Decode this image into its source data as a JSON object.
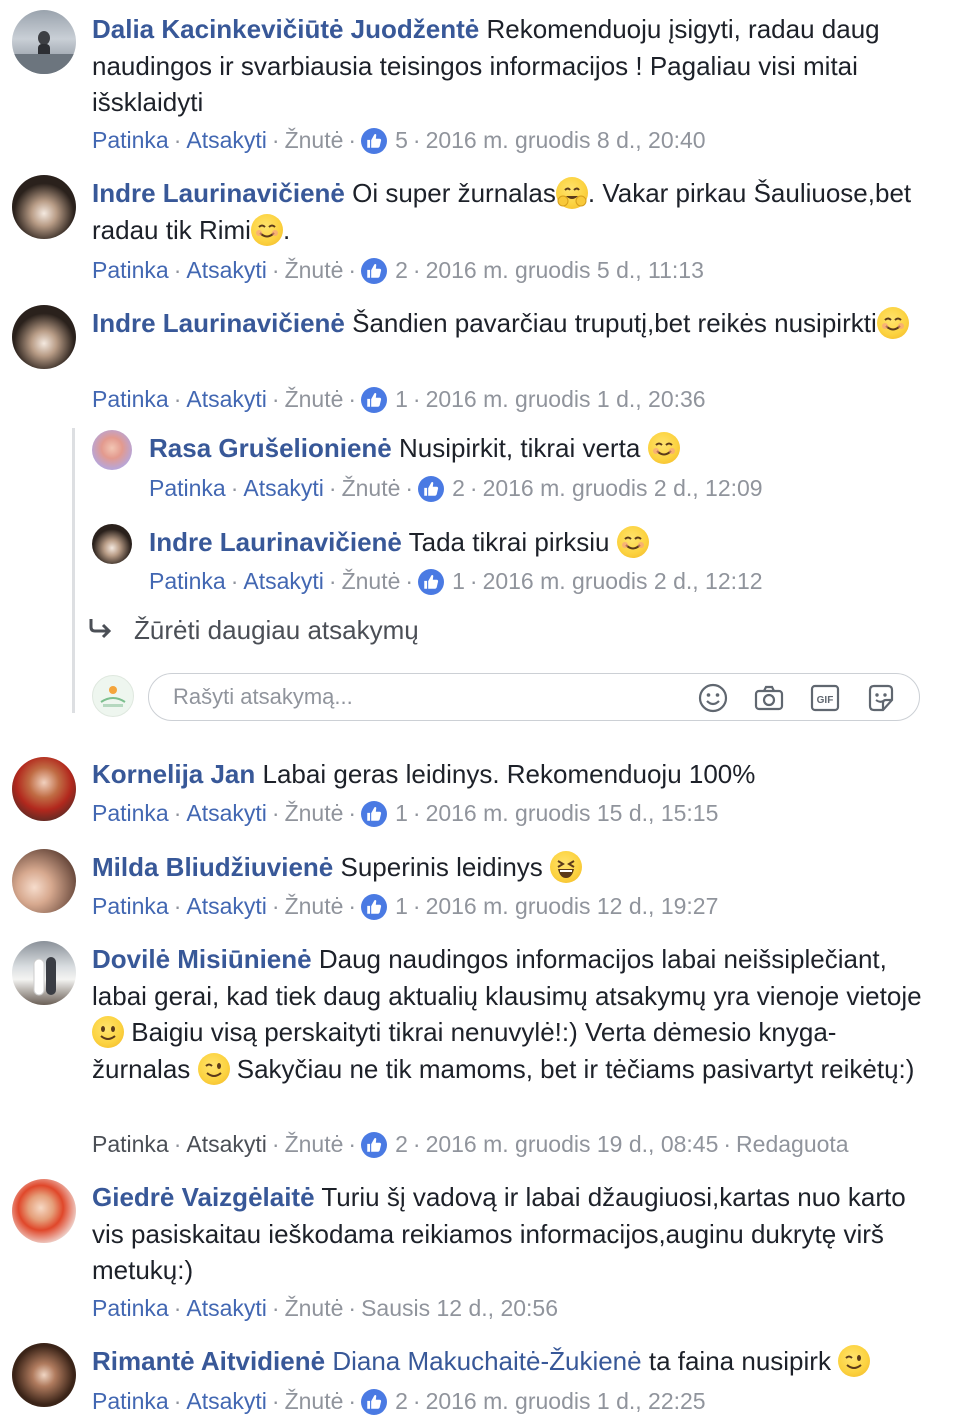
{
  "separator": "·",
  "comments": [
    {
      "author": "Dalia Kacinkevičiūtė Juodžentė",
      "text_parts": [
        "Rekomenduoju įsigyti, radau daug naudingos ir svarbiausia teisingos informacijos ! Pagaliau visi mitai išsklaidyti"
      ],
      "like_label": "Patinka",
      "reply_label": "Atsakyti",
      "emoji_label": "Žnutė",
      "like_count": "5",
      "timestamp": "2016 m. gruodis 8 d., 20:40"
    },
    {
      "author": "Indre Laurinavičienė",
      "text_parts": [
        "Oi super žurnalas",
        ". Vakar pirkau Šauliuose,bet radau tik Rimi",
        "."
      ],
      "emojis": [
        "hugging-emoji",
        "smile-emoji"
      ],
      "like_label": "Patinka",
      "reply_label": "Atsakyti",
      "emoji_label": "Žnutė",
      "like_count": "2",
      "timestamp": "2016 m. gruodis 5 d., 11:13"
    },
    {
      "author": "Indre Laurinavičienė",
      "text_parts": [
        "Šandien pavarčiau truputį,bet reikės nusipirkti"
      ],
      "emojis": [
        "smile-emoji"
      ],
      "like_label": "Patinka",
      "reply_label": "Atsakyti",
      "emoji_label": "Žnutė",
      "like_count": "1",
      "timestamp": "2016 m. gruodis 1 d., 20:36"
    },
    {
      "author": "Kornelija Jan",
      "text_parts": [
        "Labai geras leidinys. Rekomenduoju 100%"
      ],
      "like_label": "Patinka",
      "reply_label": "Atsakyti",
      "emoji_label": "Žnutė",
      "like_count": "1",
      "timestamp": "2016 m. gruodis 15 d., 15:15"
    },
    {
      "author": "Milda Bliudžiuvienė",
      "text_parts": [
        "Superinis leidinys"
      ],
      "emojis": [
        "laughing-emoji"
      ],
      "like_label": "Patinka",
      "reply_label": "Atsakyti",
      "emoji_label": "Žnutė",
      "like_count": "1",
      "timestamp": "2016 m. gruodis 12 d., 19:27"
    },
    {
      "author": "Dovilė Misiūnienė",
      "text_parts": [
        "Daug naudingos informacijos labai neišsiplečiant, labai gerai, kad tiek daug aktualių klausimų atsakymų yra vienoje vietoje",
        "Baigiu visą perskaityti tikrai nenuvylė!:) Verta dėmesio knyga-žurnalas",
        "Sakyčiau ne tik mamoms, bet ir tėčiams pasivartyt reikėtų:)"
      ],
      "emojis": [
        "slight-smile-emoji",
        "wink-emoji"
      ],
      "like_label": "Patinka",
      "reply_label": "Atsakyti",
      "emoji_label": "Žnutė",
      "like_count": "2",
      "timestamp": "2016 m. gruodis 19 d., 08:45",
      "edited": "Redaguota"
    },
    {
      "author": "Giedrė Vaizgėlaitė",
      "text_parts": [
        "Turiu šį vadovą ir labai džaugiuosi,kartas nuo karto vis pasiskaitau ieškodama reikiamos informacijos,auginu dukrytę virš metukų:)"
      ],
      "like_label": "Patinka",
      "reply_label": "Atsakyti",
      "emoji_label": "Žnutė",
      "timestamp": "Sausis 12 d., 20:56"
    },
    {
      "author": "Rimantė Aitvidienė",
      "mention": "Diana Makuchaitė-Žukienė",
      "text_parts": [
        "ta faina nusipirk"
      ],
      "emojis": [
        "wink-emoji"
      ],
      "like_label": "Patinka",
      "reply_label": "Atsakyti",
      "emoji_label": "Žnutė",
      "like_count": "2",
      "timestamp": "2016 m. gruodis 1 d., 22:25"
    }
  ],
  "replies": [
    {
      "author": "Rasa Grušelionienė",
      "text_parts": [
        "Nusipirkit, tikrai verta"
      ],
      "emojis": [
        "smile-emoji"
      ],
      "like_label": "Patinka",
      "reply_label": "Atsakyti",
      "emoji_label": "Žnutė",
      "like_count": "2",
      "timestamp": "2016 m. gruodis 2 d., 12:09"
    },
    {
      "author": "Indre Laurinavičienė",
      "text_parts": [
        "Tada tikrai pirksiu"
      ],
      "emojis": [
        "smile-emoji"
      ],
      "like_label": "Patinka",
      "reply_label": "Atsakyti",
      "emoji_label": "Žnutė",
      "like_count": "1",
      "timestamp": "2016 m. gruodis 2 d., 12:12"
    }
  ],
  "view_more_replies": "Žūrėti daugiau atsakymų",
  "reply_box": {
    "placeholder": "Rašyti atsakymą...",
    "icons": [
      "emoji-icon",
      "camera-icon",
      "gif-icon",
      "sticker-icon"
    ]
  },
  "colors": {
    "author": "#385898",
    "like_link": "#4267b2",
    "meta_gray": "#90949c",
    "like_badge": "#4a7ae3"
  }
}
